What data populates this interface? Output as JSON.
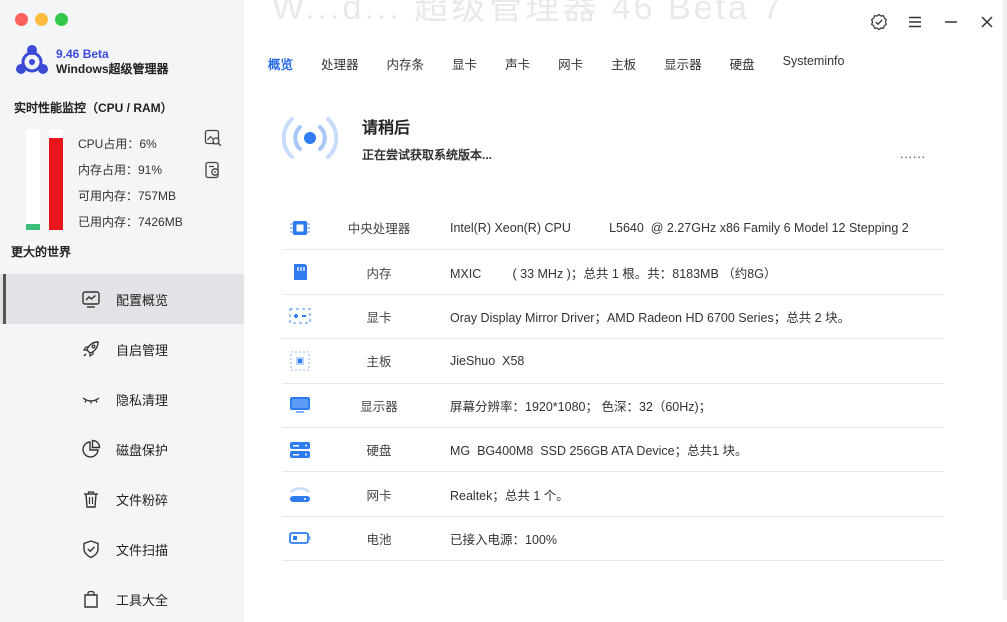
{
  "app": {
    "version": "9.46 Beta",
    "name": "Windows超级管理器"
  },
  "perf": {
    "title": "实时性能监控（CPU / RAM）",
    "cpu_label": "CPU占用：6%",
    "mem_label": "内存占用：91%",
    "avail_label": "可用内存：757MB",
    "used_label": "已用内存：7426MB",
    "cpu_percent": 6,
    "mem_percent": 91,
    "cpu_color": "#3cbf7a",
    "mem_color": "#e8161c",
    "tagline": "更大的世界"
  },
  "menu": {
    "items": [
      {
        "label": "配置概览",
        "icon": "dashboard-icon"
      },
      {
        "label": "自启管理",
        "icon": "rocket-icon"
      },
      {
        "label": "隐私清理",
        "icon": "eye-closed-icon"
      },
      {
        "label": "磁盘保护",
        "icon": "pie-chart-icon"
      },
      {
        "label": "文件粉碎",
        "icon": "trash-icon"
      },
      {
        "label": "文件扫描",
        "icon": "shield-check-icon"
      },
      {
        "label": "工具大全",
        "icon": "bag-icon"
      }
    ]
  },
  "header": {
    "ghost_title": "W...d... 超级管理器 46 Beta 7"
  },
  "tabs": [
    "概览",
    "处理器",
    "内存条",
    "显卡",
    "声卡",
    "网卡",
    "主板",
    "显示器",
    "硬盘",
    "Systeminfo"
  ],
  "loading": {
    "title": "请稍后",
    "subtitle": "正在尝试获取系统版本...",
    "dots": "......"
  },
  "rows": [
    {
      "label": "中央处理器",
      "value": "Intel(R) Xeon(R) CPU           L5640  @ 2.27GHz x86 Family 6 Model 12 Stepping 2",
      "icon": "cpu-icon"
    },
    {
      "label": "内存",
      "value": "MXIC         ( 33 MHz )；总共 1 根。共：8183MB （约8G）",
      "icon": "memory-icon"
    },
    {
      "label": "显卡",
      "value": "Oray Display Mirror Driver；AMD Radeon HD 6700 Series；总共 2 块。",
      "icon": "gpu-icon"
    },
    {
      "label": "主板",
      "value": "JieShuo  X58",
      "icon": "motherboard-icon"
    },
    {
      "label": "显示器",
      "value": "屏幕分辨率：1920*1080； 色深：32（60Hz)；",
      "icon": "monitor-icon"
    },
    {
      "label": "硬盘",
      "value": "MG  BG400M8  SSD 256GB ATA Device；总共1 块。",
      "icon": "disk-icon"
    },
    {
      "label": "网卡",
      "value": "Realtek；总共 1 个。",
      "icon": "wifi-icon"
    },
    {
      "label": "电池",
      "value": "已接入电源：100%",
      "icon": "battery-icon"
    }
  ],
  "colors": {
    "accent": "#2b6de8",
    "icon_blue": "#2f7bf0"
  }
}
